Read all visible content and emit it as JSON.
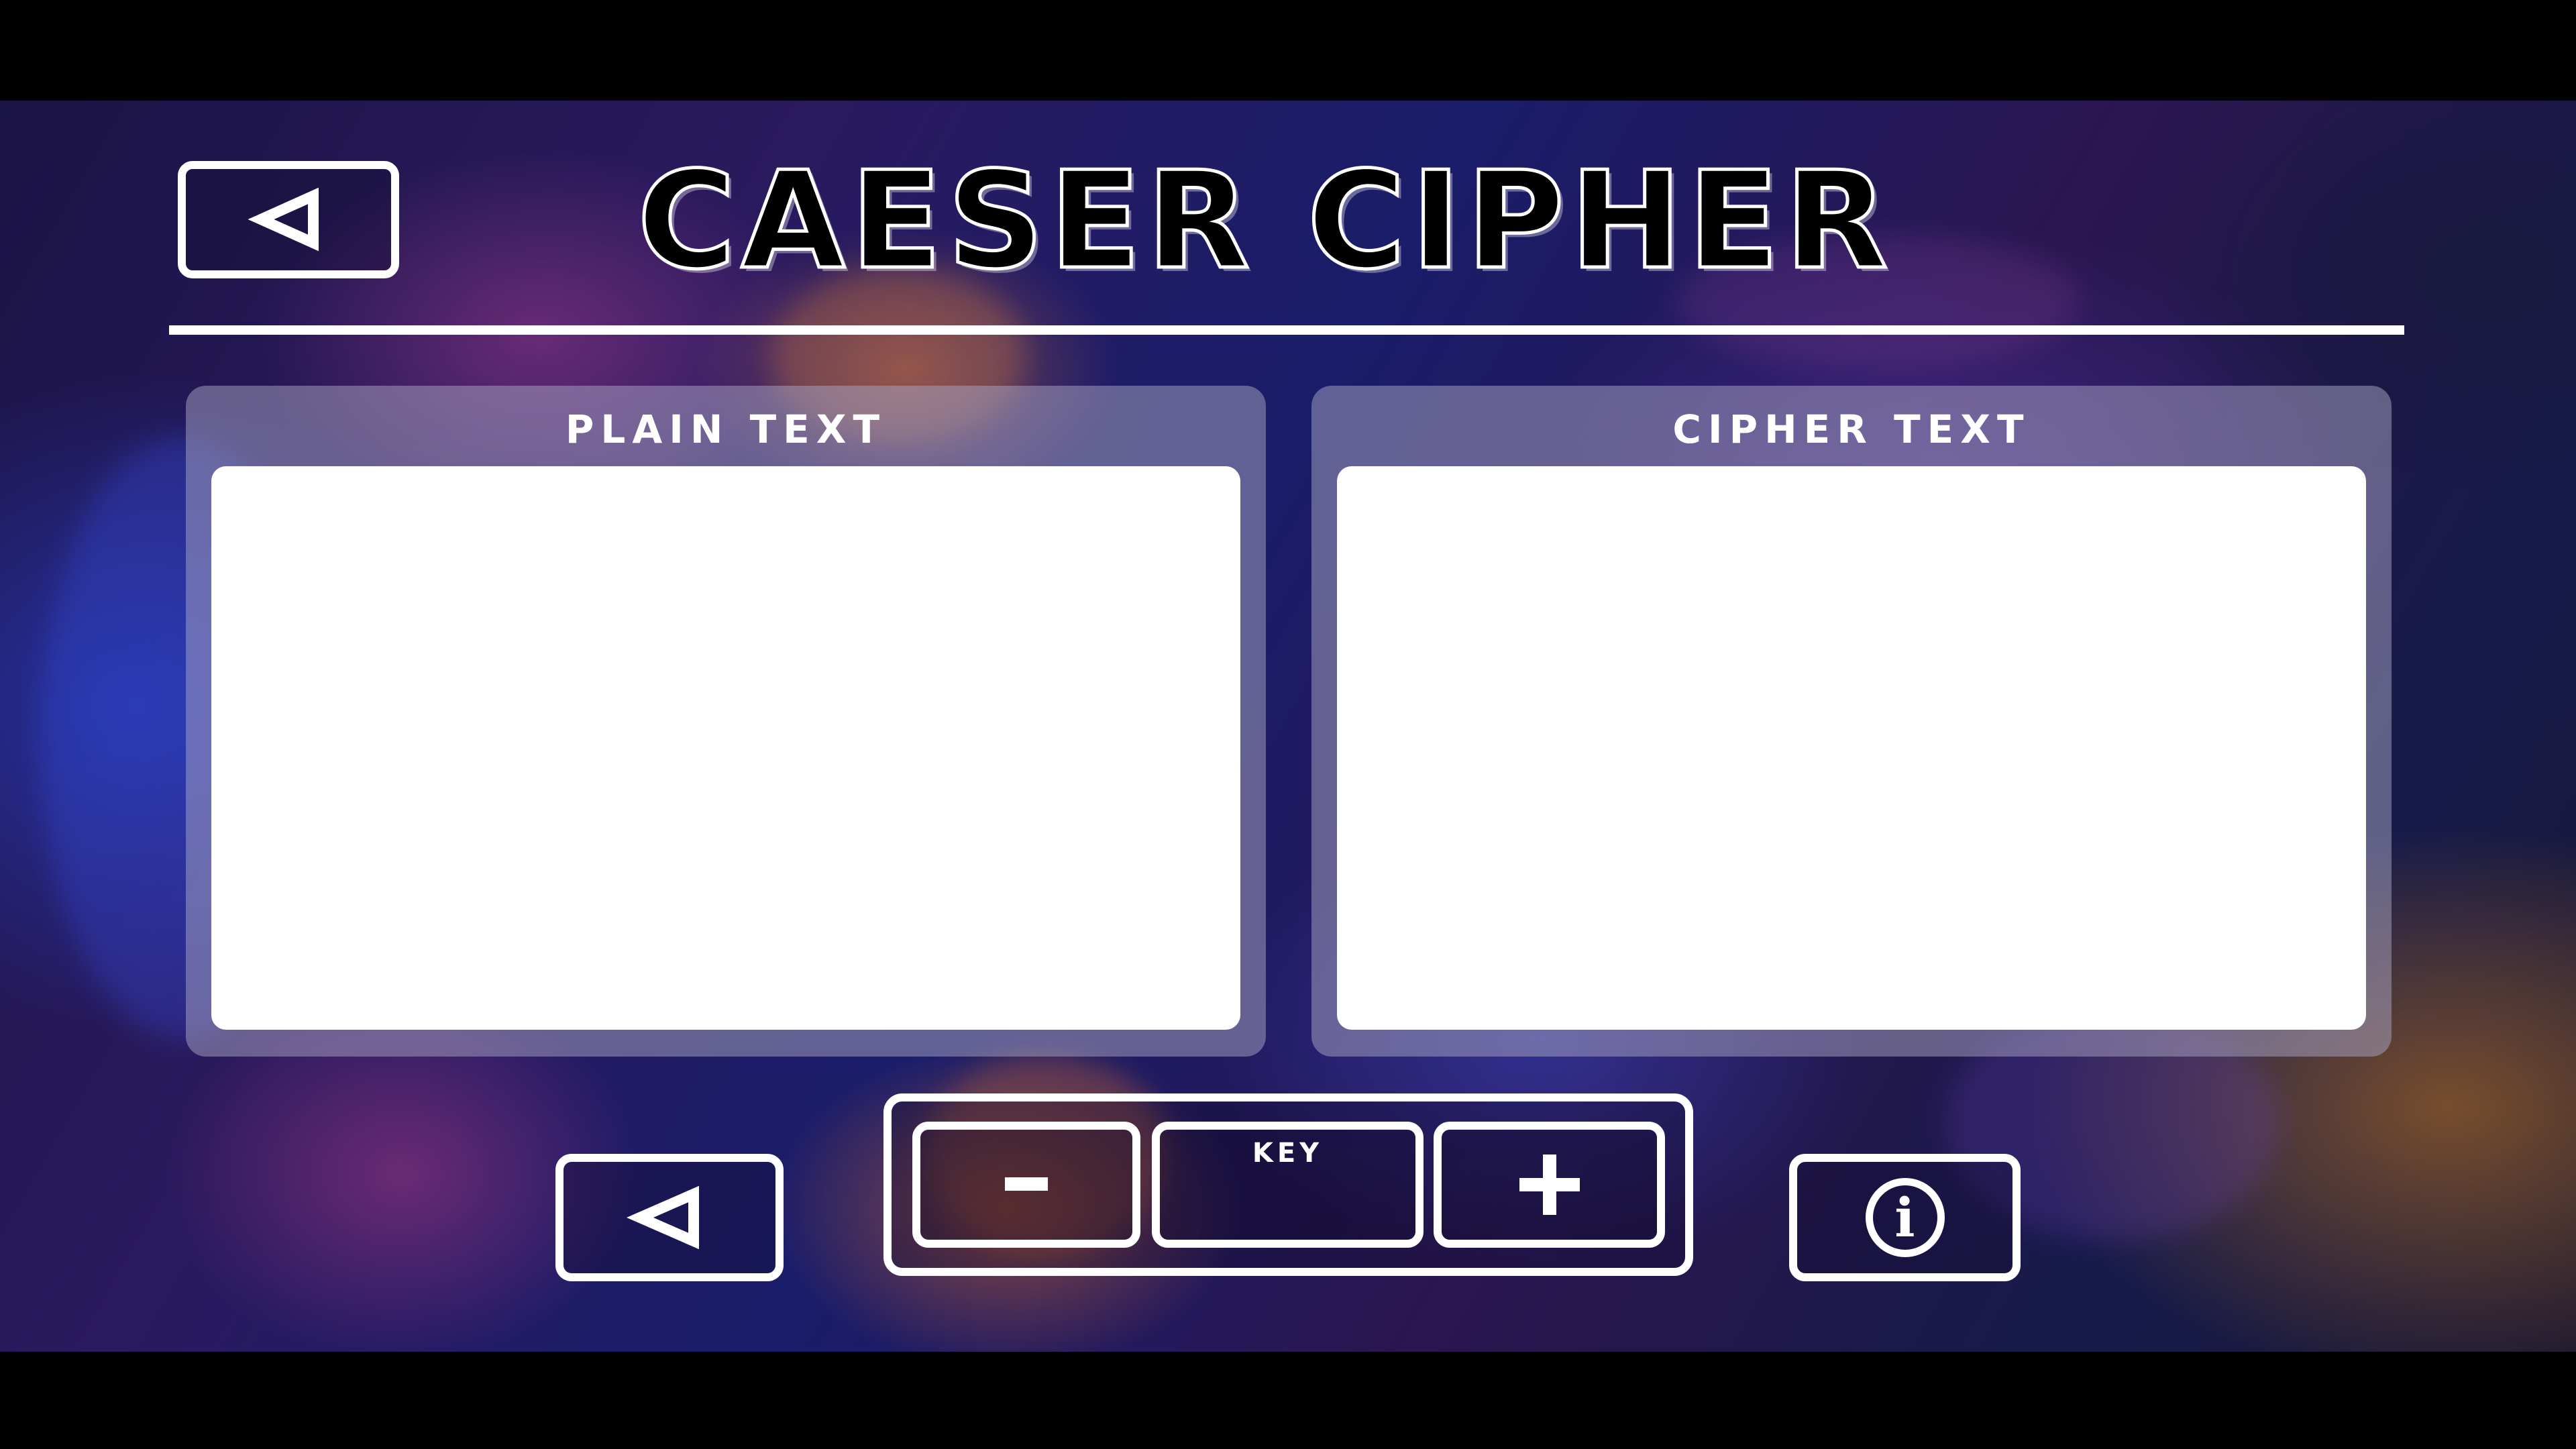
{
  "app": {
    "title": "CAESER CIPHER"
  },
  "header": {
    "back_icon": "back-triangle-icon"
  },
  "panels": {
    "plain": {
      "label": "PLAIN TEXT",
      "value": "",
      "placeholder": ""
    },
    "cipher": {
      "label": "CIPHER TEXT",
      "value": "",
      "placeholder": ""
    }
  },
  "controls": {
    "back_icon": "back-triangle-icon",
    "minus_label": "-",
    "plus_label": "+",
    "key_label": "KEY",
    "key_value": "",
    "info_icon": "info-icon"
  },
  "colors": {
    "outline": "#ffffff",
    "panel_bg": "#aaa5c3",
    "letterbox": "#000000"
  }
}
